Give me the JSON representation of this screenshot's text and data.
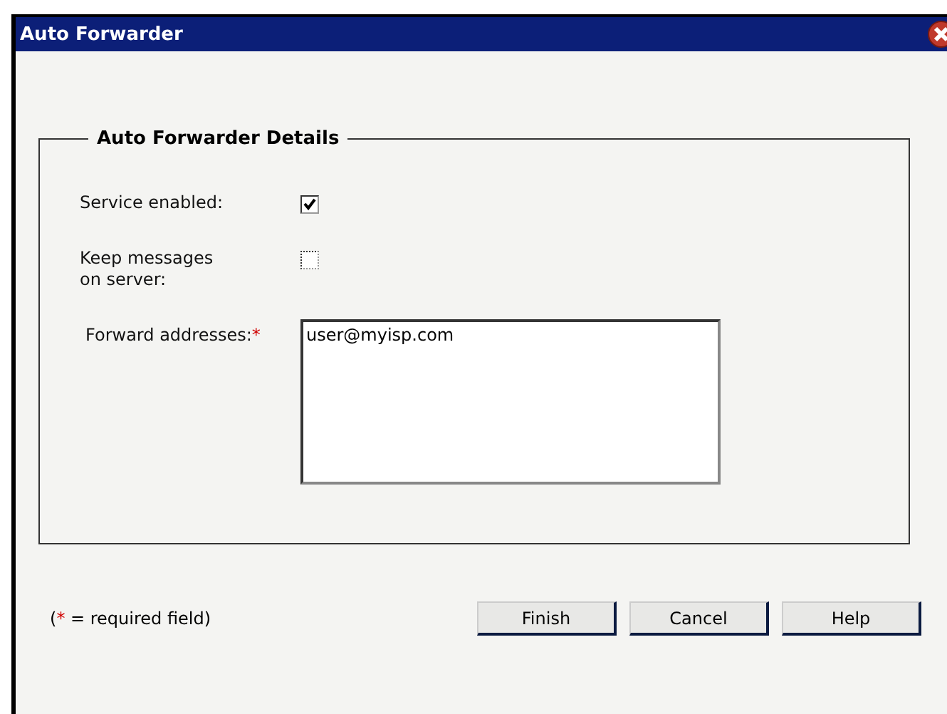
{
  "window": {
    "title": "Auto Forwarder"
  },
  "details": {
    "legend": "Auto Forwarder Details",
    "rows": [
      {
        "kind": "checkbox",
        "label": "Service enabled:",
        "checked": true
      },
      {
        "kind": "checkbox",
        "label": "Keep messages on server:",
        "checked": false
      },
      {
        "kind": "textarea",
        "label": "Forward addresses:",
        "required_mark": "*",
        "value": "user@myisp.com"
      }
    ]
  },
  "footnote": {
    "prefix": "(",
    "mark": "*",
    "suffix": " = required field)"
  },
  "buttons": [
    "Finish",
    "Cancel",
    "Help"
  ]
}
